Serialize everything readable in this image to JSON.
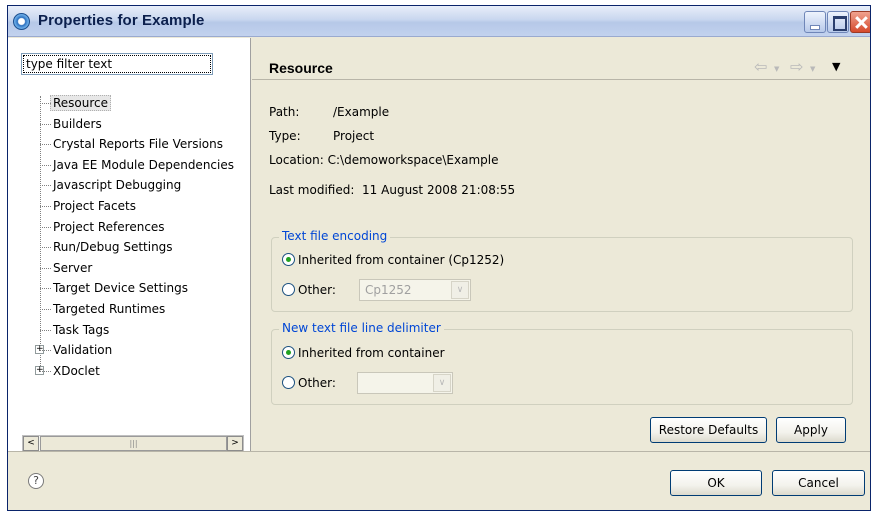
{
  "window": {
    "title": "Properties for Example"
  },
  "filter": {
    "placeholder": "type filter text"
  },
  "tree": {
    "items": [
      {
        "label": "Resource",
        "selected": true,
        "expandable": false
      },
      {
        "label": "Builders",
        "expandable": false
      },
      {
        "label": "Crystal Reports File Versions",
        "expandable": false
      },
      {
        "label": "Java EE Module Dependencies",
        "expandable": false
      },
      {
        "label": "Javascript Debugging",
        "expandable": false
      },
      {
        "label": "Project Facets",
        "expandable": false
      },
      {
        "label": "Project References",
        "expandable": false
      },
      {
        "label": "Run/Debug Settings",
        "expandable": false
      },
      {
        "label": "Server",
        "expandable": false
      },
      {
        "label": "Target Device Settings",
        "expandable": false
      },
      {
        "label": "Targeted Runtimes",
        "expandable": false
      },
      {
        "label": "Task Tags",
        "expandable": false
      },
      {
        "label": "Validation",
        "expandable": true
      },
      {
        "label": "XDoclet",
        "expandable": true
      }
    ]
  },
  "page": {
    "title": "Resource",
    "path_label": "Path:",
    "path_value": "/Example",
    "type_label": "Type:",
    "type_value": "Project",
    "location_label": "Location:",
    "location_value": "C:\\demoworkspace\\Example",
    "last_modified_label": "Last modified:",
    "last_modified_value": "11 August 2008 21:08:55"
  },
  "encoding": {
    "legend": "Text file encoding",
    "inherited_label": "Inherited from container (Cp1252)",
    "other_label": "Other:",
    "other_value": "Cp1252",
    "selected": "inherited"
  },
  "delimiter": {
    "legend": "New text file line delimiter",
    "inherited_label": "Inherited from container",
    "other_label": "Other:",
    "other_value": "",
    "selected": "inherited"
  },
  "buttons": {
    "restore_defaults": "Restore Defaults",
    "apply": "Apply",
    "ok": "OK",
    "cancel": "Cancel"
  },
  "icons": {
    "help": "?",
    "scroll_left": "<",
    "scroll_right": ">",
    "thumb_grip": "|||",
    "nav_back": "⇦",
    "nav_forward": "⇨",
    "view_menu": "▼",
    "combo_arrow": "∨"
  },
  "colors": {
    "accent": "#0046d5",
    "window_bg": "#ece9d8",
    "radio_dot": "#21a121"
  }
}
